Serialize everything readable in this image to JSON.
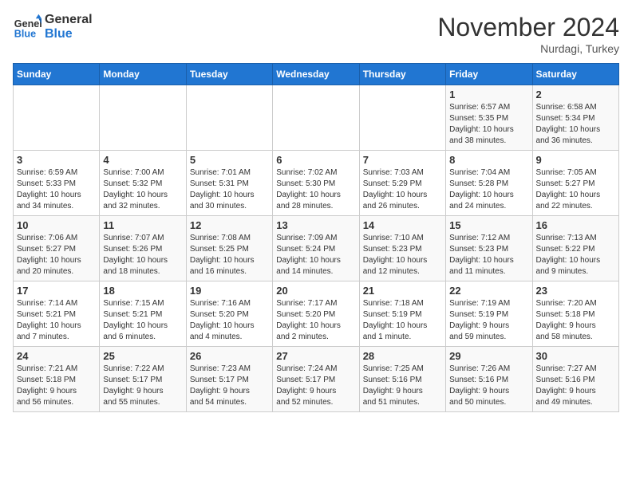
{
  "header": {
    "logo_line1": "General",
    "logo_line2": "Blue",
    "month": "November 2024",
    "location": "Nurdagi, Turkey"
  },
  "days_of_week": [
    "Sunday",
    "Monday",
    "Tuesday",
    "Wednesday",
    "Thursday",
    "Friday",
    "Saturday"
  ],
  "weeks": [
    [
      {
        "day": "",
        "info": ""
      },
      {
        "day": "",
        "info": ""
      },
      {
        "day": "",
        "info": ""
      },
      {
        "day": "",
        "info": ""
      },
      {
        "day": "",
        "info": ""
      },
      {
        "day": "1",
        "info": "Sunrise: 6:57 AM\nSunset: 5:35 PM\nDaylight: 10 hours\nand 38 minutes."
      },
      {
        "day": "2",
        "info": "Sunrise: 6:58 AM\nSunset: 5:34 PM\nDaylight: 10 hours\nand 36 minutes."
      }
    ],
    [
      {
        "day": "3",
        "info": "Sunrise: 6:59 AM\nSunset: 5:33 PM\nDaylight: 10 hours\nand 34 minutes."
      },
      {
        "day": "4",
        "info": "Sunrise: 7:00 AM\nSunset: 5:32 PM\nDaylight: 10 hours\nand 32 minutes."
      },
      {
        "day": "5",
        "info": "Sunrise: 7:01 AM\nSunset: 5:31 PM\nDaylight: 10 hours\nand 30 minutes."
      },
      {
        "day": "6",
        "info": "Sunrise: 7:02 AM\nSunset: 5:30 PM\nDaylight: 10 hours\nand 28 minutes."
      },
      {
        "day": "7",
        "info": "Sunrise: 7:03 AM\nSunset: 5:29 PM\nDaylight: 10 hours\nand 26 minutes."
      },
      {
        "day": "8",
        "info": "Sunrise: 7:04 AM\nSunset: 5:28 PM\nDaylight: 10 hours\nand 24 minutes."
      },
      {
        "day": "9",
        "info": "Sunrise: 7:05 AM\nSunset: 5:27 PM\nDaylight: 10 hours\nand 22 minutes."
      }
    ],
    [
      {
        "day": "10",
        "info": "Sunrise: 7:06 AM\nSunset: 5:27 PM\nDaylight: 10 hours\nand 20 minutes."
      },
      {
        "day": "11",
        "info": "Sunrise: 7:07 AM\nSunset: 5:26 PM\nDaylight: 10 hours\nand 18 minutes."
      },
      {
        "day": "12",
        "info": "Sunrise: 7:08 AM\nSunset: 5:25 PM\nDaylight: 10 hours\nand 16 minutes."
      },
      {
        "day": "13",
        "info": "Sunrise: 7:09 AM\nSunset: 5:24 PM\nDaylight: 10 hours\nand 14 minutes."
      },
      {
        "day": "14",
        "info": "Sunrise: 7:10 AM\nSunset: 5:23 PM\nDaylight: 10 hours\nand 12 minutes."
      },
      {
        "day": "15",
        "info": "Sunrise: 7:12 AM\nSunset: 5:23 PM\nDaylight: 10 hours\nand 11 minutes."
      },
      {
        "day": "16",
        "info": "Sunrise: 7:13 AM\nSunset: 5:22 PM\nDaylight: 10 hours\nand 9 minutes."
      }
    ],
    [
      {
        "day": "17",
        "info": "Sunrise: 7:14 AM\nSunset: 5:21 PM\nDaylight: 10 hours\nand 7 minutes."
      },
      {
        "day": "18",
        "info": "Sunrise: 7:15 AM\nSunset: 5:21 PM\nDaylight: 10 hours\nand 6 minutes."
      },
      {
        "day": "19",
        "info": "Sunrise: 7:16 AM\nSunset: 5:20 PM\nDaylight: 10 hours\nand 4 minutes."
      },
      {
        "day": "20",
        "info": "Sunrise: 7:17 AM\nSunset: 5:20 PM\nDaylight: 10 hours\nand 2 minutes."
      },
      {
        "day": "21",
        "info": "Sunrise: 7:18 AM\nSunset: 5:19 PM\nDaylight: 10 hours\nand 1 minute."
      },
      {
        "day": "22",
        "info": "Sunrise: 7:19 AM\nSunset: 5:19 PM\nDaylight: 9 hours\nand 59 minutes."
      },
      {
        "day": "23",
        "info": "Sunrise: 7:20 AM\nSunset: 5:18 PM\nDaylight: 9 hours\nand 58 minutes."
      }
    ],
    [
      {
        "day": "24",
        "info": "Sunrise: 7:21 AM\nSunset: 5:18 PM\nDaylight: 9 hours\nand 56 minutes."
      },
      {
        "day": "25",
        "info": "Sunrise: 7:22 AM\nSunset: 5:17 PM\nDaylight: 9 hours\nand 55 minutes."
      },
      {
        "day": "26",
        "info": "Sunrise: 7:23 AM\nSunset: 5:17 PM\nDaylight: 9 hours\nand 54 minutes."
      },
      {
        "day": "27",
        "info": "Sunrise: 7:24 AM\nSunset: 5:17 PM\nDaylight: 9 hours\nand 52 minutes."
      },
      {
        "day": "28",
        "info": "Sunrise: 7:25 AM\nSunset: 5:16 PM\nDaylight: 9 hours\nand 51 minutes."
      },
      {
        "day": "29",
        "info": "Sunrise: 7:26 AM\nSunset: 5:16 PM\nDaylight: 9 hours\nand 50 minutes."
      },
      {
        "day": "30",
        "info": "Sunrise: 7:27 AM\nSunset: 5:16 PM\nDaylight: 9 hours\nand 49 minutes."
      }
    ]
  ]
}
